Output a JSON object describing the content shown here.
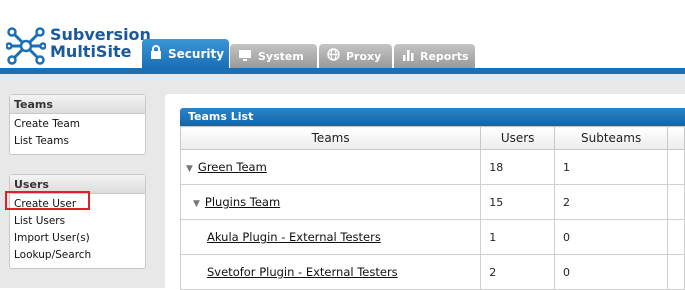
{
  "app": {
    "logo_line1": "Subversion",
    "logo_line2": "MultiSite"
  },
  "tabs": [
    {
      "label": "Security",
      "icon": "lock-icon",
      "active": true
    },
    {
      "label": "System",
      "icon": "monitor-icon",
      "active": false
    },
    {
      "label": "Proxy",
      "icon": "globe-icon",
      "active": false
    },
    {
      "label": "Reports",
      "icon": "bar-chart-icon",
      "active": false
    }
  ],
  "sidebar": {
    "teams": {
      "title": "Teams",
      "items": [
        "Create Team",
        "List Teams"
      ]
    },
    "users": {
      "title": "Users",
      "items": [
        "Create User",
        "List Users",
        "Import User(s)",
        "Lookup/Search"
      ]
    }
  },
  "main": {
    "panel_title": "Teams List",
    "columns": [
      "Teams",
      "Users",
      "Subteams"
    ],
    "rows": [
      {
        "name": "Green Team",
        "users": "18",
        "subteams": "1",
        "expanded": true
      },
      {
        "name": "Plugins Team",
        "users": "15",
        "subteams": "2",
        "expanded": true
      },
      {
        "name": "Akula Plugin - External Testers",
        "users": "1",
        "subteams": "0",
        "expanded": false
      },
      {
        "name": "Svetofor Plugin - External Testers",
        "users": "2",
        "subteams": "0",
        "expanded": false
      }
    ]
  },
  "colors": {
    "accent": "#1a6fb5",
    "highlight": "#e0202a"
  }
}
